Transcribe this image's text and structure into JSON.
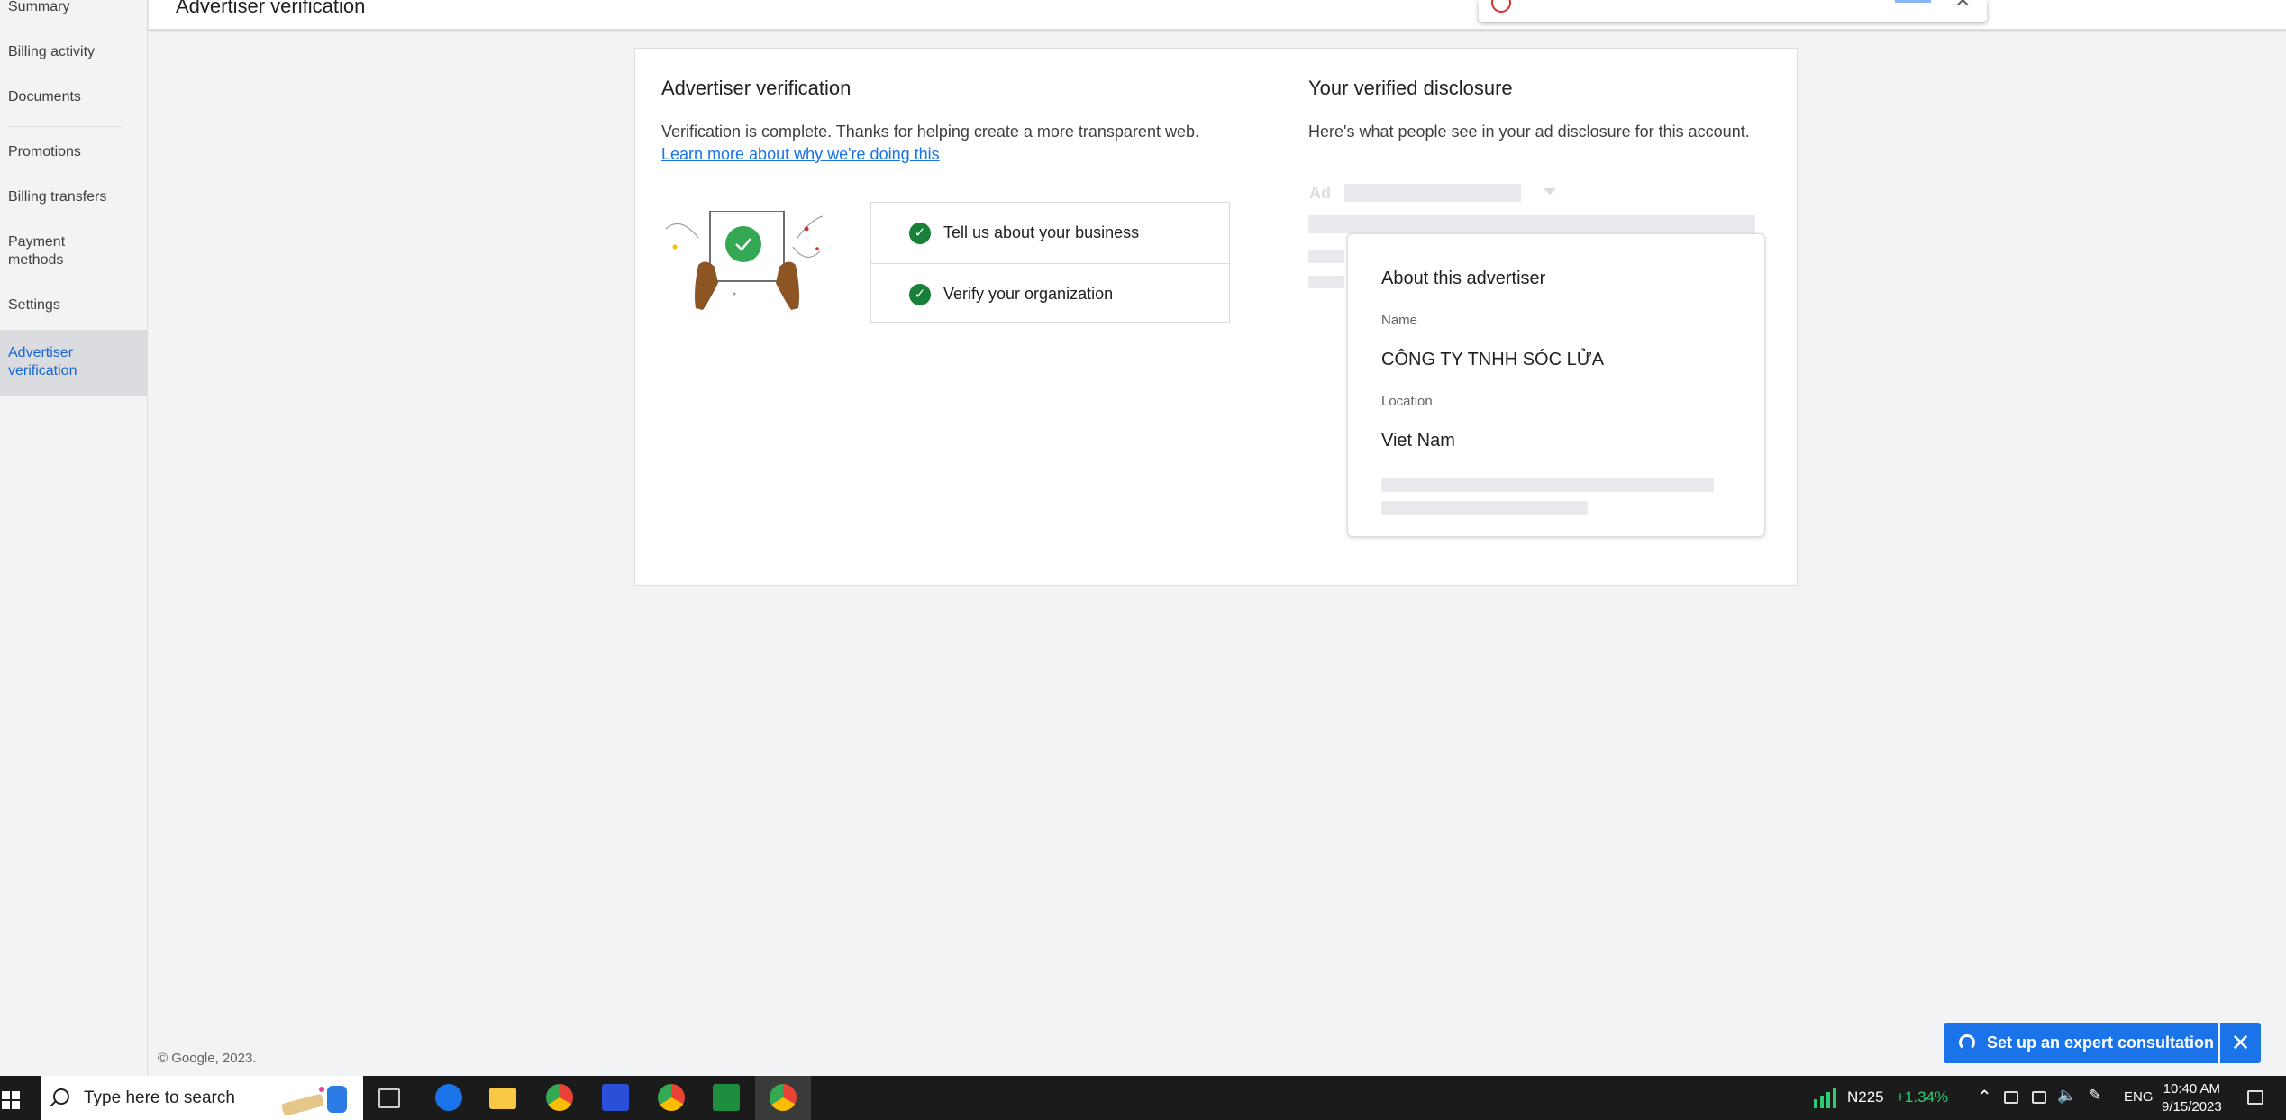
{
  "sidebar": {
    "items": [
      {
        "label": "Summary"
      },
      {
        "label": "Billing activity"
      },
      {
        "label": "Documents"
      },
      {
        "label": "Promotions"
      },
      {
        "label": "Billing transfers"
      },
      {
        "label": "Payment methods"
      },
      {
        "label": "Settings"
      },
      {
        "label": "Advertiser verification",
        "active": true
      }
    ]
  },
  "header": {
    "title": "Advertiser verification"
  },
  "verification": {
    "title": "Advertiser verification",
    "status_text": "Verification is complete. Thanks for helping create a more transparent web.",
    "learn_more": "Learn more about why we're doing this",
    "steps": [
      {
        "label": "Tell us about your business",
        "status": "complete"
      },
      {
        "label": "Verify your organization",
        "status": "complete"
      }
    ]
  },
  "disclosure": {
    "title": "Your verified disclosure",
    "description": "Here's what people see in your ad disclosure for this account.",
    "ad_label": "Ad",
    "card": {
      "title": "About this advertiser",
      "name_label": "Name",
      "name_value": "CÔNG TY TNHH SÓC LỬA",
      "location_label": "Location",
      "location_value": "Viet Nam"
    }
  },
  "footer": {
    "copyright": "© Google, 2023."
  },
  "consult": {
    "label": "Set up an expert consultation",
    "close_icon": "close-icon"
  },
  "taskbar": {
    "search_placeholder": "Type here to search",
    "stock_name": "N225",
    "stock_change": "+1.34%",
    "language": "ENG",
    "time": "10:40 AM",
    "date": "9/15/2023"
  },
  "colors": {
    "accent": "#1a73e8",
    "success": "#188038",
    "active_nav": "#1967d2"
  }
}
